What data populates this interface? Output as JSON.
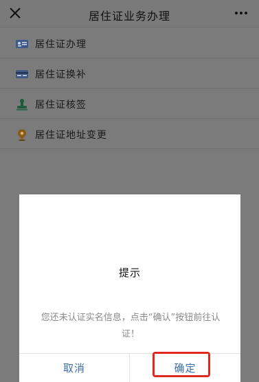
{
  "header": {
    "title": "居住证业务办理",
    "close_icon": "close-icon",
    "more_icon": "more-icon"
  },
  "menu": {
    "items": [
      {
        "label": "居住证办理",
        "icon": "id-card-icon",
        "color": "#3d5b86"
      },
      {
        "label": "居住证换补",
        "icon": "card-replace-icon",
        "color": "#3d5b86"
      },
      {
        "label": "居住证核签",
        "icon": "stamp-icon",
        "color": "#1f5a3c"
      },
      {
        "label": "居住证地址变更",
        "icon": "location-pin-icon",
        "color": "#8a5a1a"
      }
    ]
  },
  "dialog": {
    "title": "提示",
    "message": "您还未认证实名信息，点击“确认”按钮前往认证！",
    "cancel_label": "取消",
    "confirm_label": "确定"
  },
  "colors": {
    "overlay": "#7b7b7b",
    "dialog_button": "#3a6ea8",
    "highlight_border": "#e0281e"
  }
}
